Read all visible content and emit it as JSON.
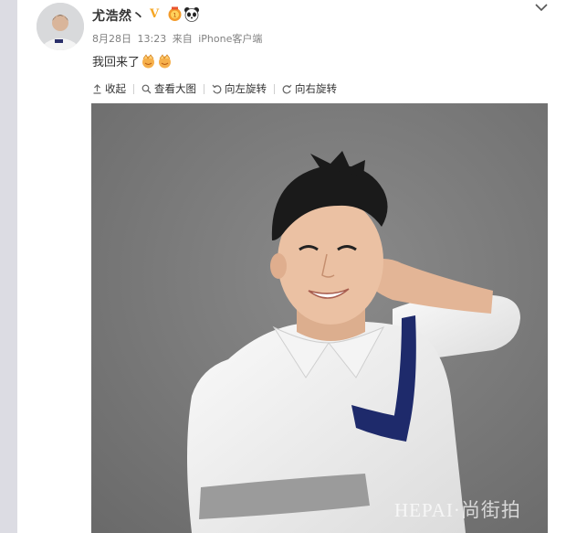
{
  "post": {
    "author": {
      "name": "尤浩然丶",
      "avatar_icon": "user-avatar",
      "verified_icon": "vip-v-icon",
      "badges": [
        "medal-icon",
        "panda-icon"
      ]
    },
    "meta": {
      "date": "8月28日",
      "time": "13:23",
      "source_prefix": "来自",
      "source": "iPhone客户端"
    },
    "text": "我回来了",
    "emojis": [
      "clap-emoji",
      "clap-emoji"
    ]
  },
  "toolbar": {
    "collapse_label": "收起",
    "view_large_label": "查看大图",
    "rotate_left_label": "向左旋转",
    "rotate_right_label": "向右旋转"
  },
  "image": {
    "watermark": "HEPAI·尚街拍"
  },
  "colors": {
    "accent_orange": "#f5a623",
    "meta_gray": "#808080",
    "photo_background": "#747474",
    "stripe_navy": "#1e2a6b"
  }
}
